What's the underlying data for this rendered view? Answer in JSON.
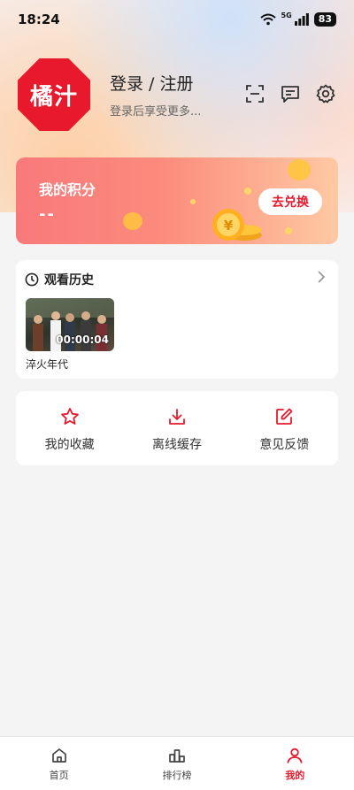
{
  "status_bar": {
    "time": "18:24",
    "signal_label": "5G",
    "battery": "83"
  },
  "profile": {
    "logo_text": "橘汁",
    "title": "登录 / 注册",
    "subtitle": "登录后享受更多...",
    "icons": [
      "scan-icon",
      "message-icon",
      "settings-icon"
    ]
  },
  "points": {
    "title": "我的积分",
    "value": "--",
    "redeem_label": "去兑换"
  },
  "history": {
    "title": "观看历史",
    "items": [
      {
        "title": "淬火年代",
        "timestamp": "00:00:04"
      }
    ]
  },
  "shortcuts": [
    {
      "label": "我的收藏",
      "icon": "star-icon"
    },
    {
      "label": "离线缓存",
      "icon": "download-icon"
    },
    {
      "label": "意见反馈",
      "icon": "edit-icon"
    }
  ],
  "nav": [
    {
      "label": "首页",
      "icon": "home-icon",
      "active": false
    },
    {
      "label": "排行榜",
      "icon": "ranking-icon",
      "active": false
    },
    {
      "label": "我的",
      "icon": "profile-icon",
      "active": true
    }
  ],
  "colors": {
    "accent": "#e8192c",
    "points_start": "#f9797b",
    "points_end": "#ffc9a3"
  }
}
